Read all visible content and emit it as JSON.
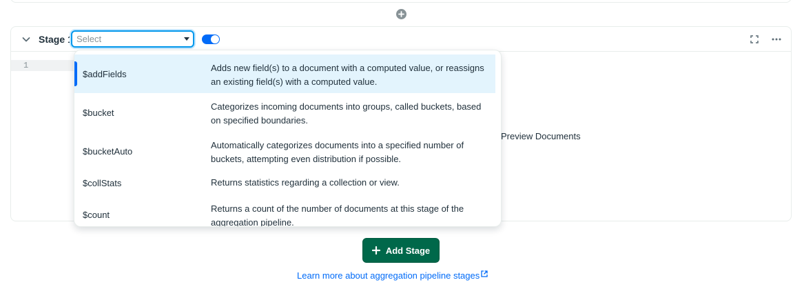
{
  "stage": {
    "label": "Stage 1",
    "select_placeholder": "Select",
    "enabled": true,
    "line_number": "1",
    "preview_text": "Preview Documents"
  },
  "operators": [
    {
      "name": "$addFields",
      "description": "Adds new field(s) to a document with a computed value, or reassigns an existing field(s) with a computed value.",
      "active": true
    },
    {
      "name": "$bucket",
      "description": "Categorizes incoming documents into groups, called buckets, based on specified boundaries.",
      "active": false
    },
    {
      "name": "$bucketAuto",
      "description": "Automatically categorizes documents into a specified number of buckets, attempting even distribution if possible.",
      "active": false
    },
    {
      "name": "$collStats",
      "description": "Returns statistics regarding a collection or view.",
      "active": false
    },
    {
      "name": "$count",
      "description": "Returns a count of the number of documents at this stage of the aggregation pipeline.",
      "active": false
    }
  ],
  "actions": {
    "add_stage_label": "Add Stage",
    "learn_more_label": "Learn more about aggregation pipeline stages"
  },
  "colors": {
    "primary_green": "#00684a",
    "link_blue": "#016bf8",
    "focus_blue": "#0498ec",
    "active_row": "#e3f4fd"
  }
}
